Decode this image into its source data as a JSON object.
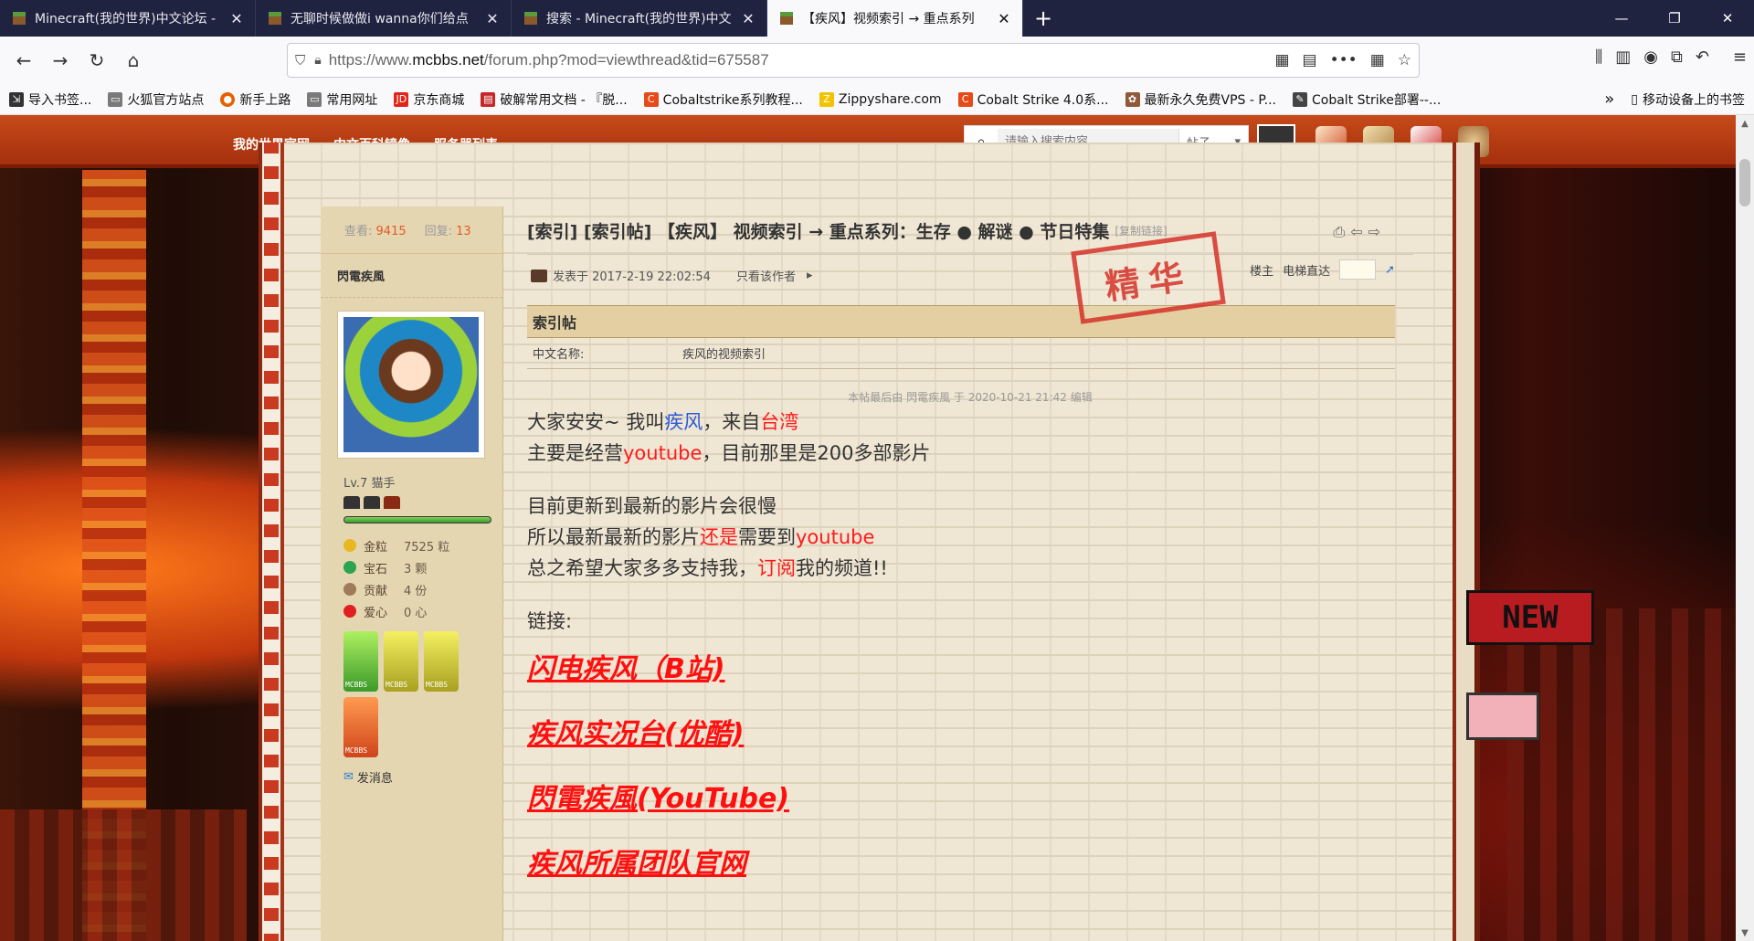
{
  "tabs": [
    {
      "title": "Minecraft(我的世界)中文论坛 -",
      "active": false
    },
    {
      "title": "无聊时候做做i wanna你们给点",
      "active": false
    },
    {
      "title": "搜索 - Minecraft(我的世界)中文",
      "active": false
    },
    {
      "title": "【疾风】视频索引 → 重点系列",
      "active": true
    }
  ],
  "url": {
    "prefix": "https://www.",
    "domain": "mcbbs.net",
    "path": "/forum.php?mod=viewthread&tid=675587"
  },
  "bookmarks": [
    {
      "label": "导入书签...",
      "color": "#333333"
    },
    {
      "label": "火狐官方站点",
      "color": "#7a7a7a"
    },
    {
      "label": "新手上路",
      "color": "#e66000"
    },
    {
      "label": "常用网址",
      "color": "#7a7a7a"
    },
    {
      "label": "京东商城",
      "color": "#e1251b"
    },
    {
      "label": "破解常用文档 - 『脱...",
      "color": "#c62828"
    },
    {
      "label": "Cobaltstrike系列教程...",
      "color": "#e64a19"
    },
    {
      "label": "Zippyshare.com",
      "color": "#f2c300"
    },
    {
      "label": "Cobalt Strike 4.0系...",
      "color": "#e64a19"
    },
    {
      "label": "最新永久免费VPS - P...",
      "color": "#8e5a3a"
    },
    {
      "label": "Cobalt Strike部署--...",
      "color": "#444444"
    }
  ],
  "bookmarks_more": "移动设备上的书签",
  "site_nav": [
    "我的世界官网",
    "中文百科镜像",
    "服务器列表"
  ],
  "search": {
    "placeholder": "请输入搜索内容",
    "type": "帖子"
  },
  "user": {
    "views_label": "查看:",
    "views": "9415",
    "replies_label": "回复:",
    "replies": "13",
    "name": "閃電疾風",
    "level": "Lv.7 猫手",
    "xp_fraction": 1.0,
    "credits": [
      {
        "label": "金粒",
        "value": "7525 粒",
        "color": "#e8b820"
      },
      {
        "label": "宝石",
        "value": "3 颗",
        "color": "#2aa44f"
      },
      {
        "label": "贡献",
        "value": "4 份",
        "color": "#a07a5a"
      },
      {
        "label": "爱心",
        "value": "0 心",
        "color": "#e02020"
      }
    ],
    "medals": [
      "MCBBS",
      "MCBBS",
      "MCBBS",
      "MCBBS"
    ],
    "pm": "发消息"
  },
  "post": {
    "title": "[索引] [索引帖] 【疾风】 视频索引 → 重点系列：生存 ● 解谜 ● 节日特集",
    "copy_link": "[复制链接]",
    "posted": "发表于 2017-2-19 22:02:54",
    "author_only": "只看该作者",
    "floor": "楼主",
    "elevator": "电梯直达",
    "stamp": "精华",
    "info_head": "索引帖",
    "info_key": "中文名称:",
    "info_value": "疾风的视频索引",
    "edited": "本帖最后由 閃電疾風 于 2020-10-21 21:42 编辑",
    "line1_a": "大家安安~ 我叫",
    "line1_b": "疾风",
    "line1_c": "，来自",
    "line1_d": "台湾",
    "line2_a": "主要是经营",
    "line2_b": "youtube",
    "line2_c": "，目前那里是200多部影片",
    "line3": "目前更新到最新的影片会很慢",
    "line4_a": "所以最新最新的影片",
    "line4_b": "还是",
    "line4_c": "需要到",
    "line4_d": "youtube",
    "line5_a": "总之希望大家多多支持我，",
    "line5_b": "订阅",
    "line5_c": "我的频道!!",
    "links_label": "链接:",
    "links": [
      "闪电疾风（B站)",
      "疾风实况台(优酷)",
      "閃電疾風(YouTube)",
      "疾风所属团队官网"
    ]
  }
}
